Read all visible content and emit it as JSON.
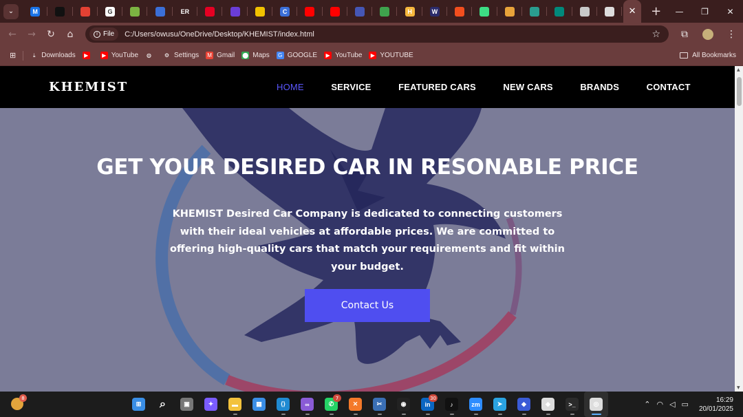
{
  "browser": {
    "tabs": [
      {
        "icon": "chevron-down-icon",
        "color": "#5a3333"
      },
      {
        "icon": "M",
        "color": "#1a73e8"
      },
      {
        "icon": "openai-icon",
        "color": "#111111"
      },
      {
        "icon": "chrome-tab-icon",
        "color": "#e34133"
      },
      {
        "icon": "G",
        "color": "#ffffff"
      },
      {
        "icon": "download-icon",
        "color": "#7cb342"
      },
      {
        "icon": "app-icon",
        "color": "#3b6fd8"
      },
      {
        "icon": "ER",
        "color": "#3a1e1e"
      },
      {
        "icon": "pinterest-icon",
        "color": "#e60023"
      },
      {
        "icon": "p-icon",
        "color": "#6a3dd8"
      },
      {
        "icon": "pin-icon",
        "color": "#f2c200"
      },
      {
        "icon": "C",
        "color": "#3b6fd8"
      },
      {
        "icon": "youtube-icon",
        "color": "#ff0000"
      },
      {
        "icon": "youtube-icon",
        "color": "#ff0000"
      },
      {
        "icon": "media-icon",
        "color": "#4556b5"
      },
      {
        "icon": "sync-icon",
        "color": "#3fa34d"
      },
      {
        "icon": "H",
        "color": "#f6b73c"
      },
      {
        "icon": "W",
        "color": "#2b2b6b"
      },
      {
        "icon": "figma-icon",
        "color": "#f24e1e"
      },
      {
        "icon": "android-icon",
        "color": "#3ddc84"
      },
      {
        "icon": "gemini-icon",
        "color": "#e8a33a"
      },
      {
        "icon": "vercel-icon",
        "color": "#2a9d8f"
      },
      {
        "icon": "meet-icon",
        "color": "#00897b"
      },
      {
        "icon": "window-icon",
        "color": "#c9c9c9"
      },
      {
        "icon": "chrome-icon",
        "color": "#dddddd"
      }
    ],
    "active_tab_close": "✕",
    "new_tab": "+",
    "url_chip": "File",
    "url": "C:/Users/owusu/OneDrive/Desktop/KHEMIST/index.html",
    "bookmarks": [
      {
        "label": "Downloads",
        "icon": "download-icon"
      },
      {
        "label": "",
        "icon": "youtube-icon"
      },
      {
        "label": "YouTube",
        "icon": "youtube-icon"
      },
      {
        "label": "",
        "icon": "globe-icon"
      },
      {
        "label": "Settings",
        "icon": "gear-icon"
      },
      {
        "label": "Gmail",
        "icon": "gmail-icon"
      },
      {
        "label": "Maps",
        "icon": "maps-icon"
      },
      {
        "label": "GOOGLE",
        "icon": "google-icon"
      },
      {
        "label": "YouTube",
        "icon": "youtube-icon"
      },
      {
        "label": "YOUTUBE",
        "icon": "youtube-icon"
      }
    ],
    "all_bookmarks": "All Bookmarks"
  },
  "site": {
    "logo": "KHEMIST",
    "nav": [
      "HOME",
      "SERVICE",
      "FEATURED CARS",
      "NEW CARS",
      "BRANDS",
      "CONTACT"
    ],
    "active_nav": "HOME",
    "hero_title": "GET YOUR DESIRED CAR IN RESONABLE PRICE",
    "hero_text": "KHEMIST Desired Car Company is dedicated to connecting customers with their ideal vehicles at affordable prices. We are committed to offering high-quality cars that match your requirements and fit within your budget.",
    "cta": "Contact Us",
    "colors": {
      "nav_bg": "#000000",
      "active_nav": "#5b57ff",
      "cta_bg": "#4f4ef0",
      "hero_overlay": "#7b7c98"
    }
  },
  "taskbar": {
    "weather_badge": "8",
    "apps": [
      {
        "name": "start",
        "icon": "windows-icon",
        "color": "#3a8ee6"
      },
      {
        "name": "search",
        "icon": "search-icon",
        "color": "#1c1c1c"
      },
      {
        "name": "task-view",
        "icon": "taskview-icon",
        "color": "#777777"
      },
      {
        "name": "copilot",
        "icon": "copilot-icon",
        "color": "#7a5cff"
      },
      {
        "name": "file-explorer",
        "icon": "folder-icon",
        "color": "#f3c23c"
      },
      {
        "name": "store",
        "icon": "store-icon",
        "color": "#3a8ee6"
      },
      {
        "name": "vscode",
        "icon": "vscode-icon",
        "color": "#1f8ad2"
      },
      {
        "name": "visual-studio",
        "icon": "visualstudio-icon",
        "color": "#8a5bd6"
      },
      {
        "name": "whatsapp",
        "icon": "whatsapp-icon",
        "color": "#25d366",
        "badge": "7"
      },
      {
        "name": "xampp",
        "icon": "xampp-icon",
        "color": "#f4792a"
      },
      {
        "name": "snip",
        "icon": "snip-icon",
        "color": "#3a6fb5"
      },
      {
        "name": "github",
        "icon": "github-icon",
        "color": "#222222"
      },
      {
        "name": "linkedin",
        "icon": "linkedin-icon",
        "color": "#0a66c2",
        "badge": "30"
      },
      {
        "name": "tiktok",
        "icon": "tiktok-icon",
        "color": "#111111"
      },
      {
        "name": "zoom",
        "icon": "zoom-icon",
        "color": "#2d8cff"
      },
      {
        "name": "telegram",
        "icon": "telegram-icon",
        "color": "#2aa3e0"
      },
      {
        "name": "app-blue",
        "icon": "app-icon",
        "color": "#3a5bd6"
      },
      {
        "name": "app-white",
        "icon": "app-icon",
        "color": "#dddddd"
      },
      {
        "name": "terminal",
        "icon": "terminal-icon",
        "color": "#2b2b2b"
      },
      {
        "name": "chrome",
        "icon": "chrome-icon",
        "color": "#dddddd"
      }
    ],
    "time": "16:29",
    "date": "20/01/2025"
  }
}
